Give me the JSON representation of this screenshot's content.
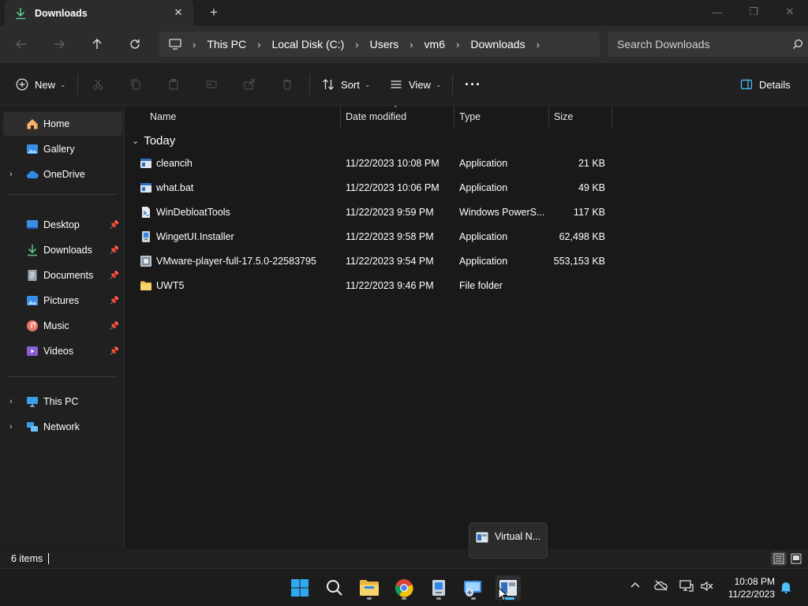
{
  "window": {
    "tab_title": "Downloads",
    "close_tab": "✕",
    "new_tab": "+",
    "minimize": "—",
    "restore": "❐",
    "close": "✕"
  },
  "nav": {
    "breadcrumbs": [
      "This PC",
      "Local Disk (C:)",
      "Users",
      "vm6",
      "Downloads"
    ],
    "search_placeholder": "Search Downloads"
  },
  "toolbar": {
    "new_label": "New",
    "sort_label": "Sort",
    "view_label": "View",
    "more_label": "···",
    "details_label": "Details"
  },
  "sidebar": {
    "items": [
      {
        "label": "Home",
        "icon": "home-icon"
      },
      {
        "label": "Gallery",
        "icon": "gallery-icon"
      },
      {
        "label": "OneDrive",
        "icon": "onedrive-icon"
      },
      {
        "label": "Desktop",
        "icon": "desktop-icon"
      },
      {
        "label": "Downloads",
        "icon": "downloads-icon"
      },
      {
        "label": "Documents",
        "icon": "documents-icon"
      },
      {
        "label": "Pictures",
        "icon": "pictures-icon"
      },
      {
        "label": "Music",
        "icon": "music-icon"
      },
      {
        "label": "Videos",
        "icon": "videos-icon"
      },
      {
        "label": "This PC",
        "icon": "this-pc-icon"
      },
      {
        "label": "Network",
        "icon": "network-icon"
      }
    ]
  },
  "columns": {
    "name": "Name",
    "date": "Date modified",
    "type": "Type",
    "size": "Size"
  },
  "group_label": "Today",
  "files": [
    {
      "name": "cleancih",
      "date": "11/22/2023 10:08 PM",
      "type": "Application",
      "size": "21 KB",
      "icon": "application-icon"
    },
    {
      "name": "what.bat",
      "date": "11/22/2023 10:06 PM",
      "type": "Application",
      "size": "49 KB",
      "icon": "application-icon"
    },
    {
      "name": "WinDebloatTools",
      "date": "11/22/2023 9:59 PM",
      "type": "Windows PowerS...",
      "size": "117 KB",
      "icon": "powershell-script-icon"
    },
    {
      "name": "WingetUI.Installer",
      "date": "11/22/2023 9:58 PM",
      "type": "Application",
      "size": "62,498 KB",
      "icon": "installer-icon"
    },
    {
      "name": "VMware-player-full-17.5.0-22583795",
      "date": "11/22/2023 9:54 PM",
      "type": "Application",
      "size": "553,153 KB",
      "icon": "vmware-icon"
    },
    {
      "name": "UWT5",
      "date": "11/22/2023 9:46 PM",
      "type": "File folder",
      "size": "",
      "icon": "folder-icon"
    }
  ],
  "status": {
    "item_count": "6 items"
  },
  "tooltip": {
    "label": "Virtual N..."
  },
  "taskbar": {
    "time": "10:08 PM",
    "date": "11/22/2023"
  },
  "colors": {
    "accent": "#4cc2ff",
    "folder": "#f0c24a"
  }
}
